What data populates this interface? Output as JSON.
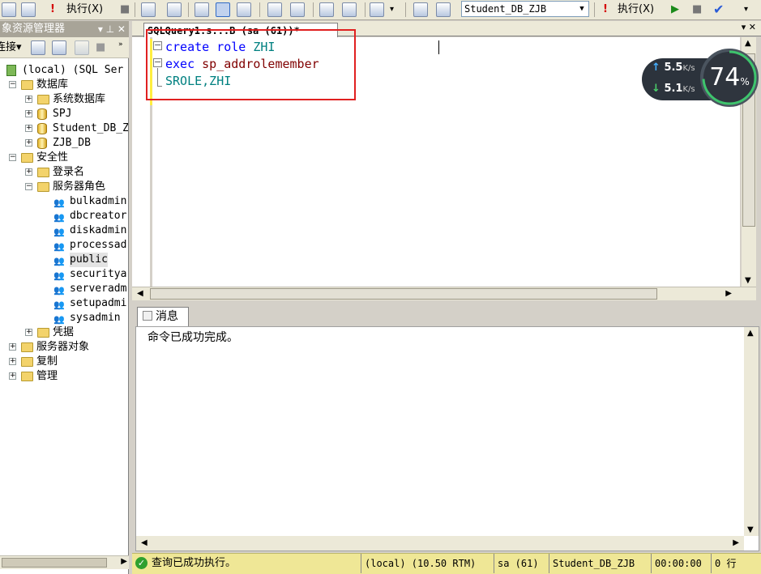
{
  "toolbar": {
    "execute1": "执行(X)",
    "execute2": "执行(X)",
    "database": "Student_DB_ZJB"
  },
  "object_explorer": {
    "title": "象资源管理器",
    "title_controls": "▾ ⊥ ✕",
    "connect_label": "连接▾",
    "tree": [
      {
        "label": "(local) (SQL Ser",
        "type": "server",
        "expand": ""
      },
      {
        "label": "数据库",
        "type": "folder",
        "expand": "−"
      },
      {
        "label": "系统数据库",
        "type": "folder",
        "expand": "+"
      },
      {
        "label": "SPJ",
        "type": "db",
        "expand": "+"
      },
      {
        "label": "Student_DB_Z",
        "type": "db",
        "expand": "+"
      },
      {
        "label": "ZJB_DB",
        "type": "db",
        "expand": "+"
      },
      {
        "label": "安全性",
        "type": "folder",
        "expand": "−"
      },
      {
        "label": "登录名",
        "type": "folder",
        "expand": "+"
      },
      {
        "label": "服务器角色",
        "type": "folder",
        "expand": "−"
      },
      {
        "label": "bulkadmin",
        "type": "role",
        "expand": ""
      },
      {
        "label": "dbcreator",
        "type": "role",
        "expand": ""
      },
      {
        "label": "diskadmin",
        "type": "role",
        "expand": ""
      },
      {
        "label": "processad",
        "type": "role",
        "expand": ""
      },
      {
        "label": "public",
        "type": "role",
        "expand": "",
        "selected": true
      },
      {
        "label": "securitya",
        "type": "role",
        "expand": ""
      },
      {
        "label": "serveradm",
        "type": "role",
        "expand": ""
      },
      {
        "label": "setupadmi",
        "type": "role",
        "expand": ""
      },
      {
        "label": "sysadmin",
        "type": "role",
        "expand": ""
      },
      {
        "label": "凭据",
        "type": "folder",
        "expand": "+"
      },
      {
        "label": "服务器对象",
        "type": "folder",
        "expand": "+"
      },
      {
        "label": "复制",
        "type": "folder",
        "expand": "+"
      },
      {
        "label": "管理",
        "type": "folder",
        "expand": "+"
      }
    ]
  },
  "editor": {
    "tab_title": "SQLQuery1.s...B (sa (61))*",
    "lines": [
      [
        {
          "t": "create",
          "c": "kw"
        },
        {
          "t": " role ",
          "c": "kw"
        },
        {
          "t": "ZHI",
          "c": "id"
        }
      ],
      [
        {
          "t": "exec",
          "c": "kw"
        },
        {
          "t": " sp_addrolemember",
          "c": "sp"
        }
      ],
      [
        {
          "t": "SROLE,ZHI",
          "c": "id"
        }
      ]
    ]
  },
  "network_widget": {
    "upload_speed": "5.5",
    "download_speed": "5.1",
    "unit": "K/s",
    "percent": "74",
    "percent_sign": "%"
  },
  "results": {
    "tab_label": "消息",
    "message": "命令已成功完成。"
  },
  "status_bar": {
    "message": "查询已成功执行。",
    "server": "(local) (10.50 RTM)",
    "user": "sa (61)",
    "database": "Student_DB_ZJB",
    "elapsed": "00:00:00",
    "rows": "0 行"
  }
}
